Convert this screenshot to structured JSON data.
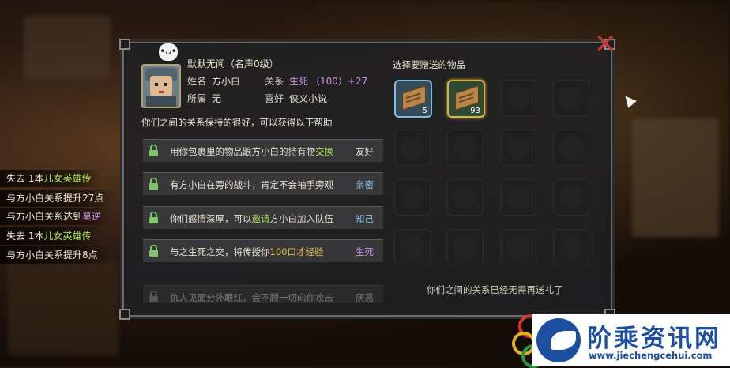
{
  "log_lines": [
    {
      "prefix": "失去 1本",
      "highlight": "儿女英雄传",
      "suffix": "",
      "color": "green"
    },
    {
      "prefix": "与方小白关系提升27点",
      "highlight": "",
      "suffix": "",
      "color": ""
    },
    {
      "prefix": "与方小白关系达到",
      "highlight": "莫逆",
      "suffix": "",
      "color": "purple"
    },
    {
      "prefix": "失去 1本",
      "highlight": "儿女英雄传",
      "suffix": "",
      "color": "green"
    },
    {
      "prefix": "与方小白关系提升8点",
      "highlight": "",
      "suffix": "",
      "color": ""
    }
  ],
  "npc": {
    "mood_icon": "speech-bubble-face-icon",
    "title": "默默无闻（名声0级）",
    "name_label": "姓名",
    "name": "方小白",
    "faction_label": "所属",
    "faction": "无",
    "relation_label": "关系",
    "relation": "生死",
    "relation_value": "（100）+27",
    "hobby_label": "喜好",
    "hobby": "侠义小说"
  },
  "help_intro": "你们之间的关系保持的很好，可以获得以下帮助",
  "help_rows": [
    {
      "pre": "用你包裹里的物品跟方小白的持有物",
      "hl": "交换",
      "post": "",
      "level": "友好",
      "level_color": "#e8e2d0",
      "hl_color": "#a8e05a"
    },
    {
      "pre": "有方小白在旁的战斗，肯定不会袖手旁观",
      "hl": "",
      "post": "",
      "level": "亲密",
      "level_color": "#7fc0e6",
      "hl_color": ""
    },
    {
      "pre": "你们感情深厚，可以",
      "hl": "邀请",
      "post": "方小白加入队伍",
      "level": "知己",
      "level_color": "#7fc0e6",
      "hl_color": "#a8e05a"
    },
    {
      "pre": "与之生死之交，将传授你",
      "hl": "100口才经验",
      "post": "",
      "level": "生死",
      "level_color": "#c98ee8",
      "hl_color": "#e2c04a"
    },
    {
      "pre": "仇人见面分外眼红，会不顾一切向你攻击",
      "hl": "",
      "post": "",
      "level": "厌恶",
      "level_color": "#e8e2d0",
      "hl_color": ""
    }
  ],
  "gift": {
    "title": "选择要赠送的物品",
    "items": [
      {
        "icon": "book-icon",
        "count": "5"
      },
      {
        "icon": "book-icon",
        "count": "93"
      }
    ],
    "footer": "你们之间的关系已经无需再送礼了"
  },
  "watermark": {
    "title": "阶乘资讯网",
    "url": "www.jiechengcehui.com"
  }
}
